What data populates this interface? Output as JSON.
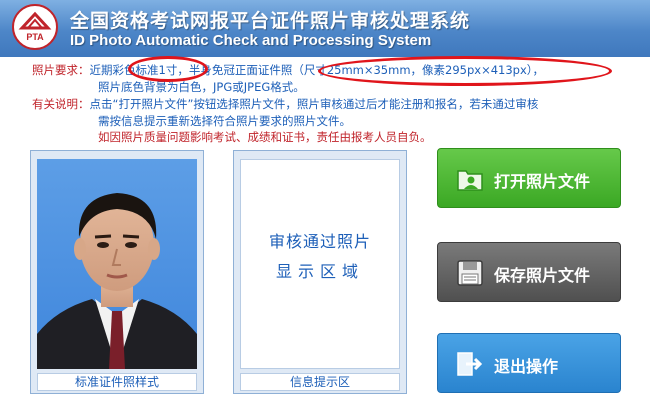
{
  "header": {
    "title_cn": "全国资格考试网报平台证件照片审核处理系统",
    "title_en": "ID Photo Automatic Check and Processing System",
    "logo_text": "PTA"
  },
  "requirements": {
    "label1": "照片要求：",
    "line1a": "近期彩色标准1寸，半身免冠正面证件照（尺寸25mm×35mm，像素295px×413px），",
    "line1b": "照片底色背景为白色，JPG或JPEG格式。",
    "label2": "有关说明：",
    "line2a": "点击“打开照片文件”按钮选择照片文件，照片审核通过后才能注册和报名，若未通过审核",
    "line2b": "需按信息提示重新选择符合照片要求的照片文件。",
    "line2c": "如因照片质量问题影响考试、成绩和证书，责任由报考人员自负。"
  },
  "sample": {
    "caption": "标准证件照样式"
  },
  "info": {
    "line1": "审核通过照片",
    "line2": "显示区域",
    "caption": "信息提示区"
  },
  "buttons": {
    "open": "打开照片文件",
    "save": "保存照片文件",
    "exit": "退出操作"
  },
  "colors": {
    "header_blue": "#4d86c8",
    "text_blue": "#1d5fb8",
    "label_red": "#c0242b",
    "open_green": "#3ba824",
    "save_gray": "#505050",
    "exit_blue": "#2a84cf",
    "annotation_red": "#e0151b"
  },
  "icons": {
    "open": "open-folder-icon",
    "save": "save-disk-icon",
    "exit": "exit-arrow-icon"
  }
}
